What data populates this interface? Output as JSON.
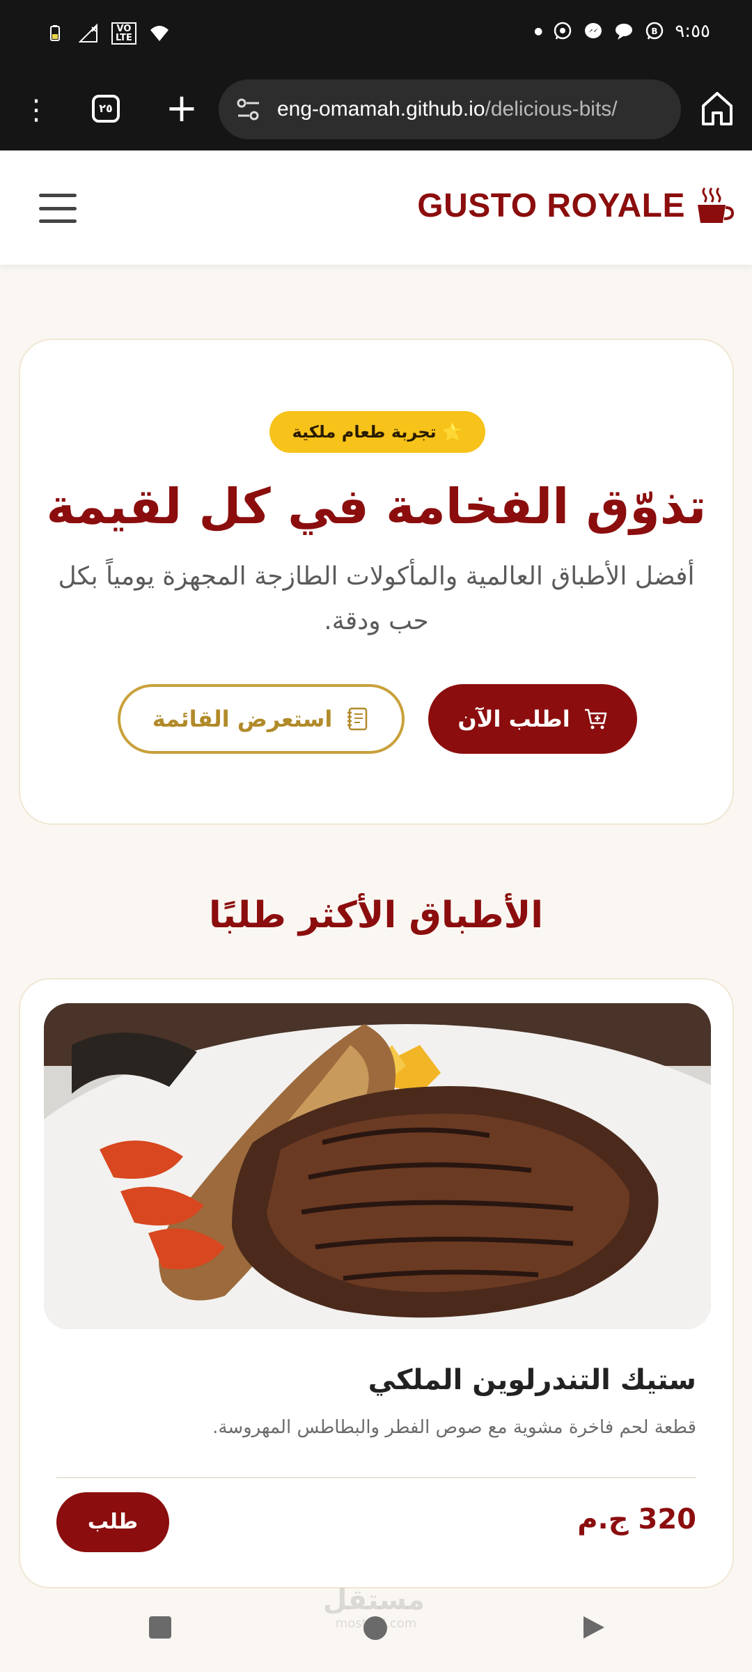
{
  "status_bar": {
    "time": "٩:٥٥",
    "network_badge_top": "VO",
    "network_badge_bottom": "LTE",
    "left_icons": [
      "battery-icon",
      "no-signal-icon",
      "volte-icon",
      "wifi-icon"
    ],
    "right_icons": [
      "dot-icon",
      "whatsapp-icon",
      "messenger-icon",
      "chat-icon",
      "whatsapp-business-icon"
    ]
  },
  "browser": {
    "tab_count": "٢٥",
    "url_host": "eng-omamah.github.io",
    "url_path": "/delicious-bits/"
  },
  "header": {
    "brand": "GUSTO ROYALE",
    "brand_color": "#8b0d0d"
  },
  "hero": {
    "badge": "تجربة طعام ملكية",
    "badge_icon": "⭐",
    "title": "تذوّق الفخامة في كل لقيمة",
    "subtitle": "أفضل الأطباق العالمية والمأكولات الطازجة المجهزة يومياً بكل حب ودقة.",
    "order_button": "اطلب الآن",
    "menu_button": "استعرض القائمة"
  },
  "popular": {
    "title": "الأطباق الأكثر طلبًا",
    "items": [
      {
        "name": "ستيك التندرلوين الملكي",
        "description": "قطعة لحم فاخرة مشوية مع صوص الفطر والبطاطس المهروسة.",
        "price": "320 ج.م",
        "order_label": "طلب"
      }
    ]
  },
  "watermark": {
    "arabic": "مستقل",
    "latin": "mostaql.com"
  },
  "colors": {
    "accent": "#8b0d0d",
    "gold": "#c9a13a",
    "badge": "#f7c219",
    "background": "#faf7f2"
  }
}
